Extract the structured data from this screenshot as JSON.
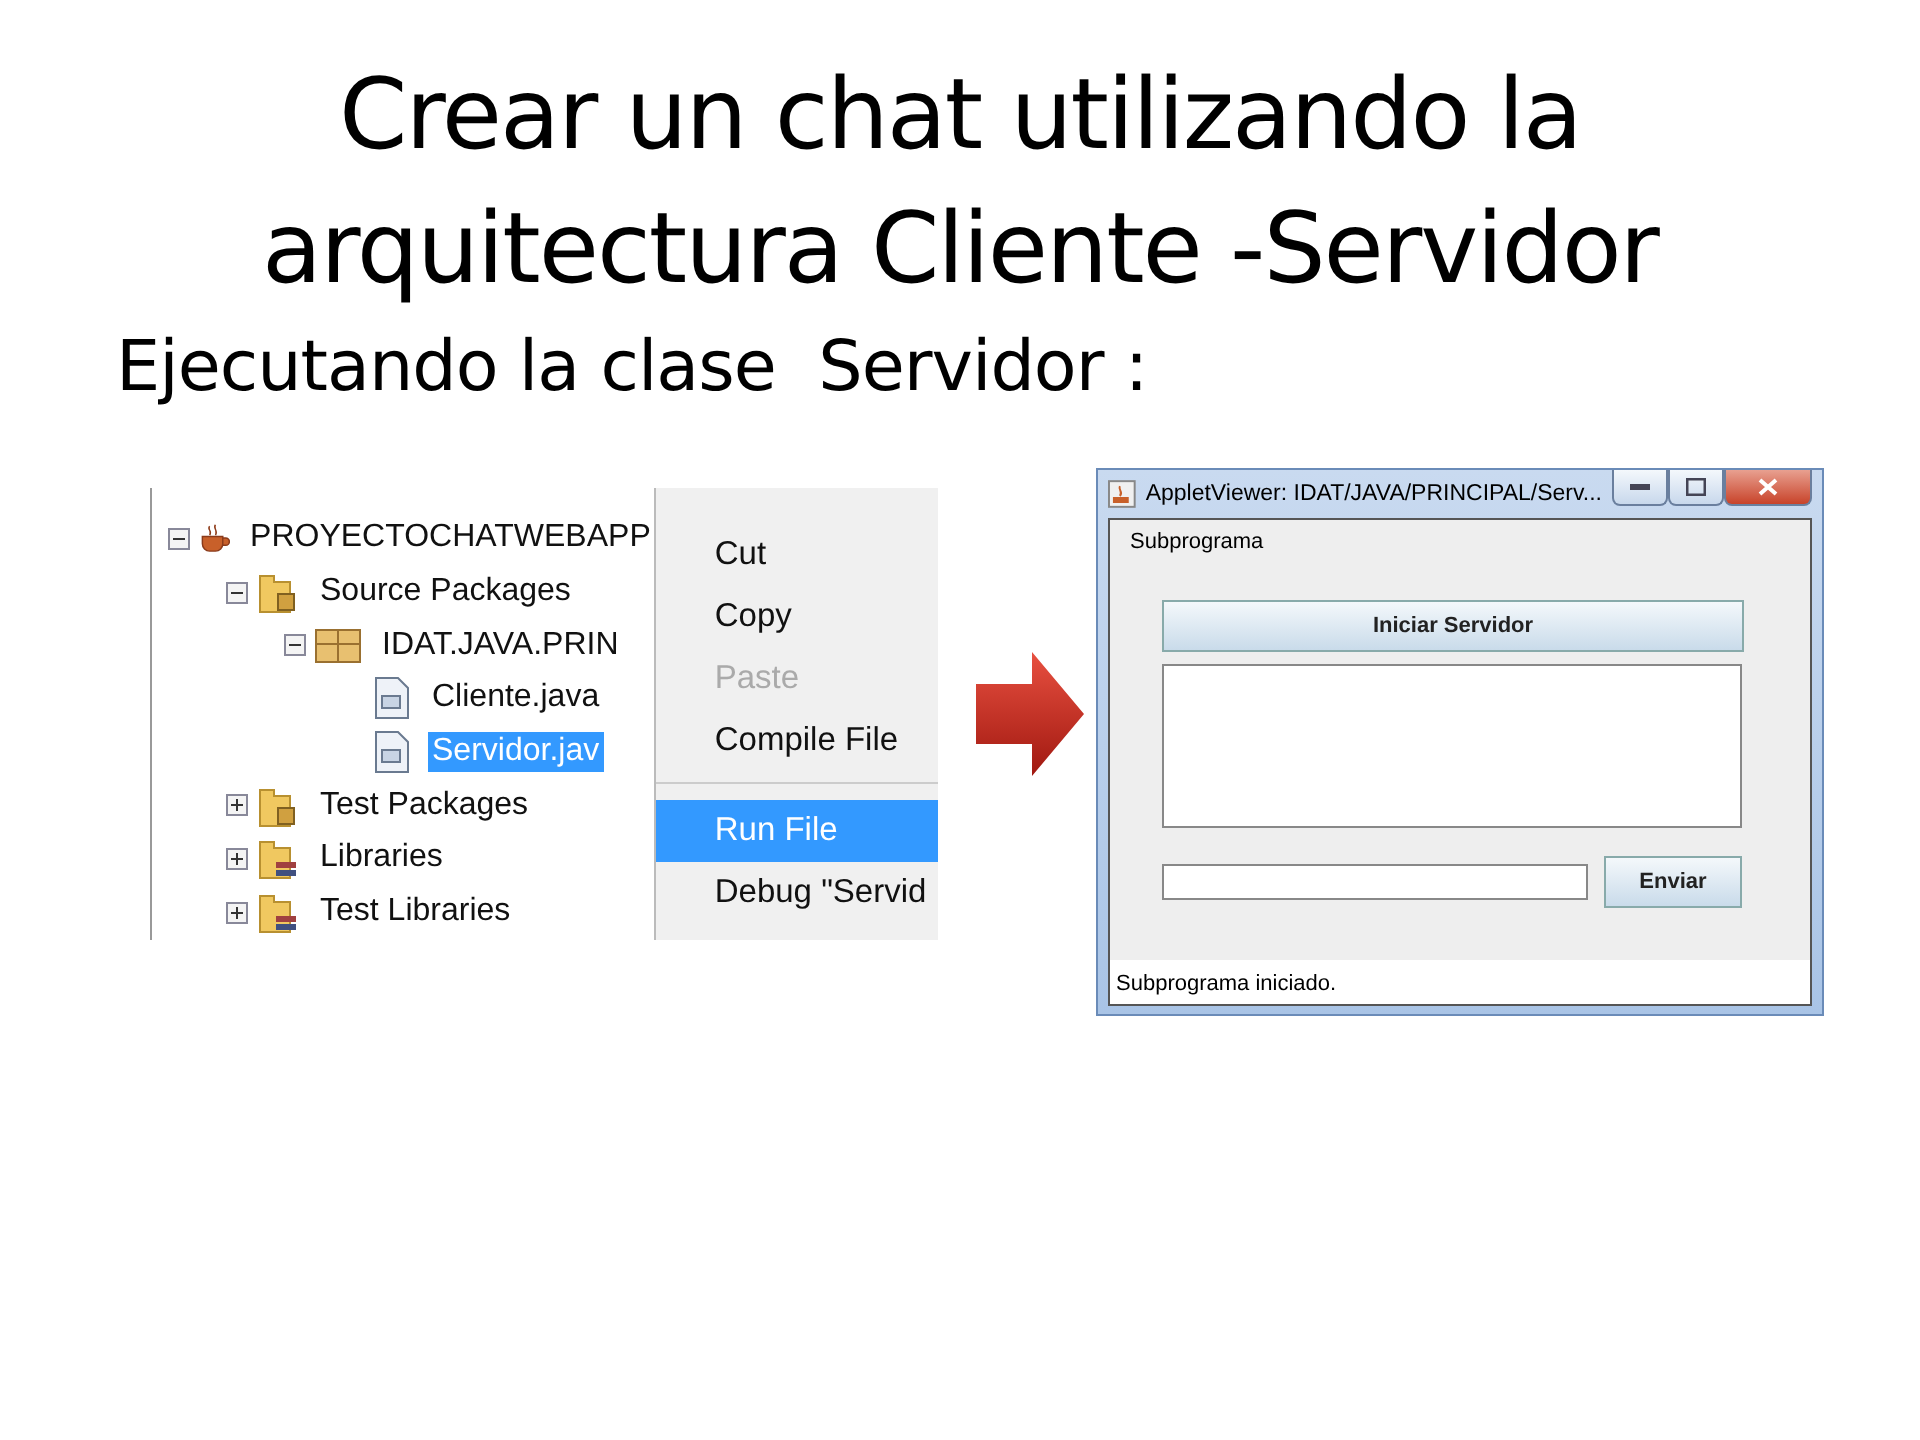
{
  "slide": {
    "title": "Crear un chat utilizando la arquitectura Cliente -Servidor",
    "subtitle": "Ejecutando la clase  Servidor :"
  },
  "project_tree": [
    {
      "label": "PROYECTOCHATWEBAPP",
      "kind": "project",
      "expanded": true,
      "selected": false,
      "children": [
        {
          "label": "Source Packages",
          "kind": "folder",
          "expanded": true,
          "selected": false,
          "children": [
            {
              "label": "IDAT.JAVA.PRIN",
              "kind": "package",
              "expanded": true,
              "selected": false,
              "children": [
                {
                  "label": "Cliente.java",
                  "kind": "file",
                  "selected": false
                },
                {
                  "label": "Servidor.jav",
                  "kind": "file",
                  "selected": true
                }
              ]
            }
          ]
        },
        {
          "label": "Test Packages",
          "kind": "folder",
          "expanded": false,
          "selected": false
        },
        {
          "label": "Libraries",
          "kind": "library",
          "expanded": false,
          "selected": false
        },
        {
          "label": "Test Libraries",
          "kind": "library",
          "expanded": false,
          "selected": false
        }
      ]
    }
  ],
  "context_menu": [
    {
      "label": "Cut",
      "disabled": false,
      "selected": false,
      "divider_before": false
    },
    {
      "label": "Copy",
      "disabled": false,
      "selected": false,
      "divider_before": false
    },
    {
      "label": "Paste",
      "disabled": true,
      "selected": false,
      "divider_before": false
    },
    {
      "label": "Compile File",
      "disabled": false,
      "selected": false,
      "divider_before": false
    },
    {
      "label": "Run File",
      "disabled": false,
      "selected": true,
      "divider_before": true
    },
    {
      "label": "Debug \"Servid",
      "disabled": false,
      "selected": false,
      "divider_before": false
    }
  ],
  "applet_window": {
    "title": "AppletViewer: IDAT/JAVA/PRINCIPAL/Serv...",
    "menu": "Subprograma",
    "start_button": "Iniciar  Servidor",
    "send_button": "Enviar",
    "status": "Subprograma iniciado."
  }
}
